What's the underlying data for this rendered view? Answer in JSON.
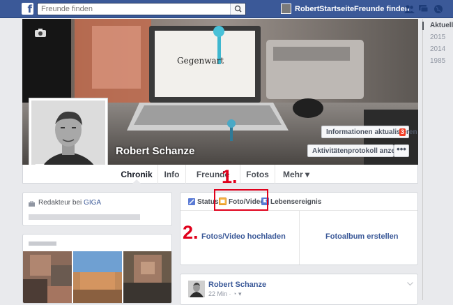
{
  "header": {
    "search_placeholder": "Freunde finden",
    "user_name": "Robert",
    "home_label": "Startseite",
    "find_friends_label": "Freunde finden",
    "brand_color": "#3b5998"
  },
  "cover": {
    "laptop_screen_text": "Gegenwart",
    "update_info_label": "Informationen aktualisieren",
    "update_info_badge": "3",
    "activity_log_label": "Aktivitätenprotokoll anzeigen",
    "more_label": "•••"
  },
  "profile": {
    "name": "Robert Schanze"
  },
  "tabs": [
    {
      "label": "Chronik",
      "active": true
    },
    {
      "label": "Info"
    },
    {
      "label": "Freunde"
    },
    {
      "label": "Fotos"
    },
    {
      "label": "Mehr ▾"
    }
  ],
  "timeline_years": [
    "Aktuell",
    "2015",
    "2014",
    "1985"
  ],
  "about": {
    "job_prefix": "Redakteur bei ",
    "job_company": "GIGA"
  },
  "composer": {
    "status_label": "Status",
    "photo_video_label": "Foto/Video",
    "life_event_label": "Lebensereignis",
    "upload_label": "Fotos/Video hochladen",
    "album_label": "Fotoalbum erstellen"
  },
  "annotations": {
    "step1": "1.",
    "step2": "2.",
    "color": "#e0001b"
  },
  "post": {
    "author": "Robert Schanze",
    "time": "22 Min · ◔ ▾"
  }
}
